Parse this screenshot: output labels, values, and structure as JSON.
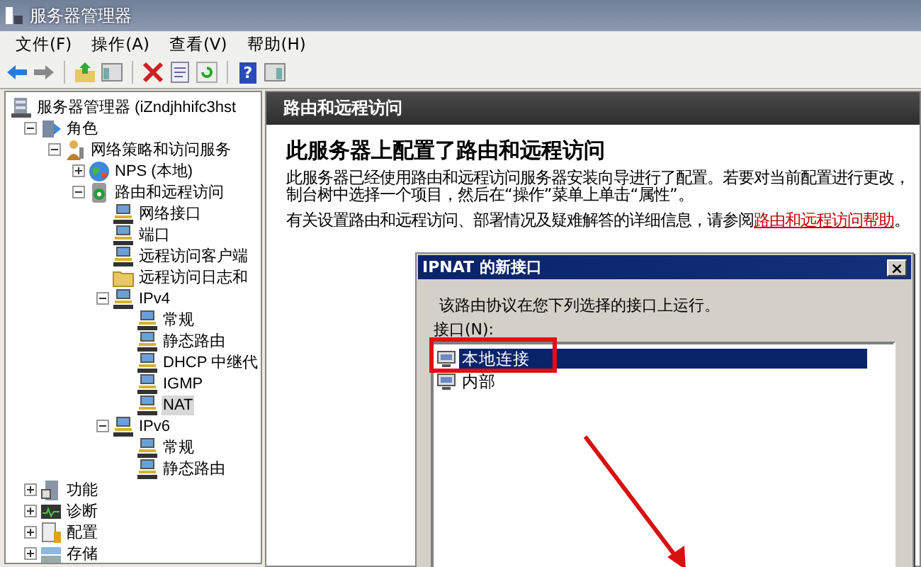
{
  "window": {
    "title": "服务器管理器"
  },
  "toolbar": {
    "help_glyph": "?"
  },
  "menu": [
    {
      "label": "文件(F)"
    },
    {
      "label": "操作(A)"
    },
    {
      "label": "查看(V)"
    },
    {
      "label": "帮助(H)"
    }
  ],
  "tree": [
    {
      "label": "服务器管理器 (iZndjhhifc3hst",
      "kind": "server",
      "selected": false,
      "children": [
        {
          "label": "角色",
          "kind": "roles",
          "expanded": true,
          "selected": false,
          "children": [
            {
              "label": "网络策略和访问服务",
              "kind": "user",
              "expanded": true,
              "selected": false,
              "children": [
                {
                  "label": "NPS (本地)",
                  "kind": "globe",
                  "expanded": false,
                  "selected": false
                },
                {
                  "label": "路由和远程访问",
                  "kind": "router",
                  "expanded": true,
                  "selected": false,
                  "children": [
                    {
                      "label": "网络接口",
                      "kind": "computer",
                      "selected": false
                    },
                    {
                      "label": "端口",
                      "kind": "computer",
                      "selected": false
                    },
                    {
                      "label": "远程访问客户端",
                      "kind": "computer",
                      "selected": false
                    },
                    {
                      "label": "远程访问日志和",
                      "kind": "folder",
                      "selected": false
                    },
                    {
                      "label": "IPv4",
                      "kind": "computer",
                      "expanded": true,
                      "selected": false,
                      "children": [
                        {
                          "label": "常规",
                          "kind": "computer",
                          "selected": false
                        },
                        {
                          "label": "静态路由",
                          "kind": "computer",
                          "selected": false
                        },
                        {
                          "label": "DHCP 中继代",
                          "kind": "computer",
                          "selected": false
                        },
                        {
                          "label": "IGMP",
                          "kind": "computer",
                          "selected": false
                        },
                        {
                          "label": "NAT",
                          "kind": "computer",
                          "selected": true
                        }
                      ]
                    },
                    {
                      "label": "IPv6",
                      "kind": "computer",
                      "expanded": true,
                      "selected": false,
                      "children": [
                        {
                          "label": "常规",
                          "kind": "computer",
                          "selected": false
                        },
                        {
                          "label": "静态路由",
                          "kind": "computer",
                          "selected": false
                        }
                      ]
                    }
                  ]
                }
              ]
            }
          ]
        },
        {
          "label": "功能",
          "kind": "features",
          "expanded": false,
          "selected": false
        },
        {
          "label": "诊断",
          "kind": "diagnostics",
          "expanded": false,
          "selected": false
        },
        {
          "label": "配置",
          "kind": "config",
          "expanded": false,
          "selected": false
        },
        {
          "label": "存储",
          "kind": "storage",
          "expanded": false,
          "selected": false
        }
      ]
    }
  ],
  "detail": {
    "header": "路由和远程访问",
    "heading": "此服务器上配置了路由和远程访问",
    "lines": [
      "此服务器已经使用路由和远程访问服务器安装向导进行了配置。若要对当前配置进行更改，",
      "制台树中选择一个项目，然后在“操作”菜单上单击“属性”。"
    ],
    "help": {
      "text": "有关设置路由和远程访问、部署情况及疑难解答的详细信息，请参阅",
      "link": "路由和远程访问帮助",
      "after": "。"
    }
  },
  "dialog": {
    "title": "IPNAT 的新接口",
    "close": "×",
    "prompt": "该路由协议在您下列选择的接口上运行。",
    "list_label": "接口(N):",
    "interfaces": [
      {
        "label": "本地连接",
        "selected": true
      },
      {
        "label": "内部",
        "selected": false
      }
    ]
  }
}
